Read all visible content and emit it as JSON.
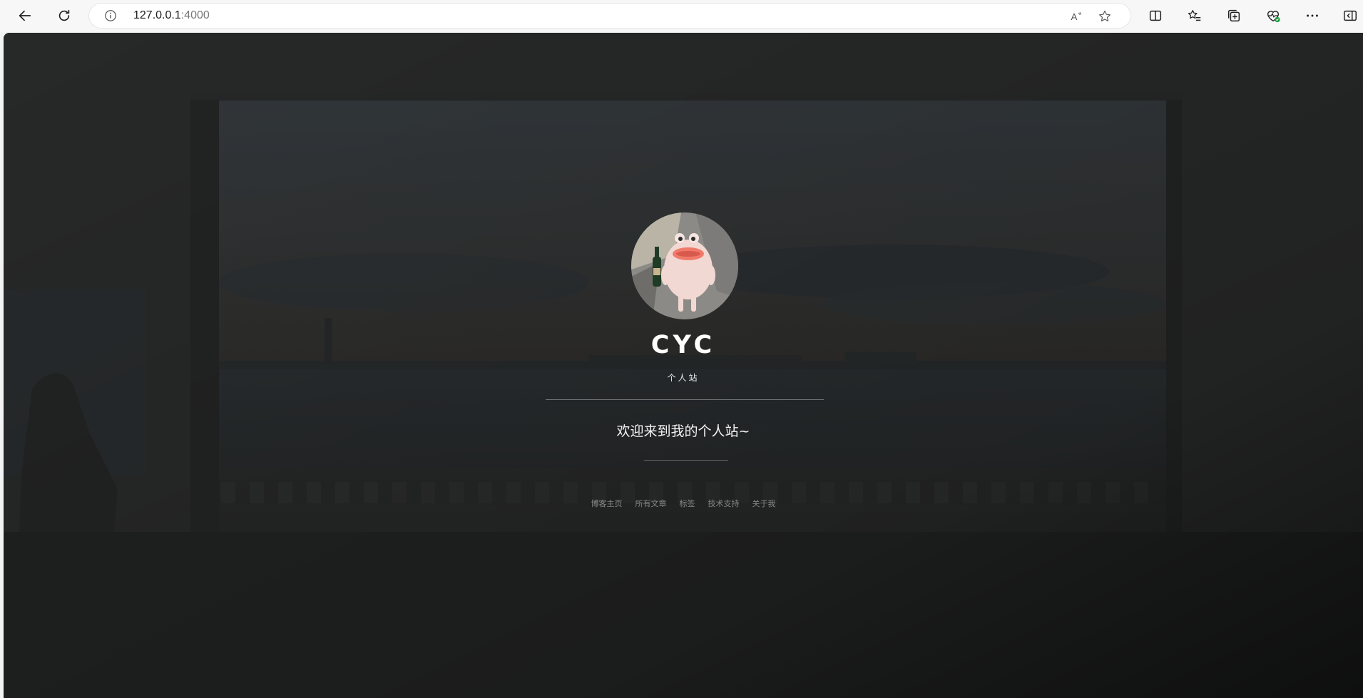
{
  "browser": {
    "url_host": "127.0.0.1",
    "url_port": ":4000",
    "icons": {
      "back": "arrow-left-icon",
      "reload": "reload-icon",
      "site_info": "info-icon",
      "read_aloud": "read-aloud-icon",
      "favorite": "star-icon",
      "split_screen": "split-screen-icon",
      "favorites": "favorites-list-icon",
      "collections": "collections-icon",
      "browser_essentials": "heart-pulse-icon",
      "more": "more-dots-icon",
      "sidebar": "sidebar-icon"
    }
  },
  "profile": {
    "title": "CYC",
    "subtitle": "个人站",
    "welcome": "欢迎来到我的个人站~"
  },
  "nav": {
    "items": [
      {
        "label": "博客主页"
      },
      {
        "label": "所有文章"
      },
      {
        "label": "标签"
      },
      {
        "label": "技术支持"
      },
      {
        "label": "关于我"
      }
    ]
  },
  "colors": {
    "overlay": "#2a2b2c",
    "title": "#ffffff",
    "nav_text": "#8a8a8a"
  }
}
